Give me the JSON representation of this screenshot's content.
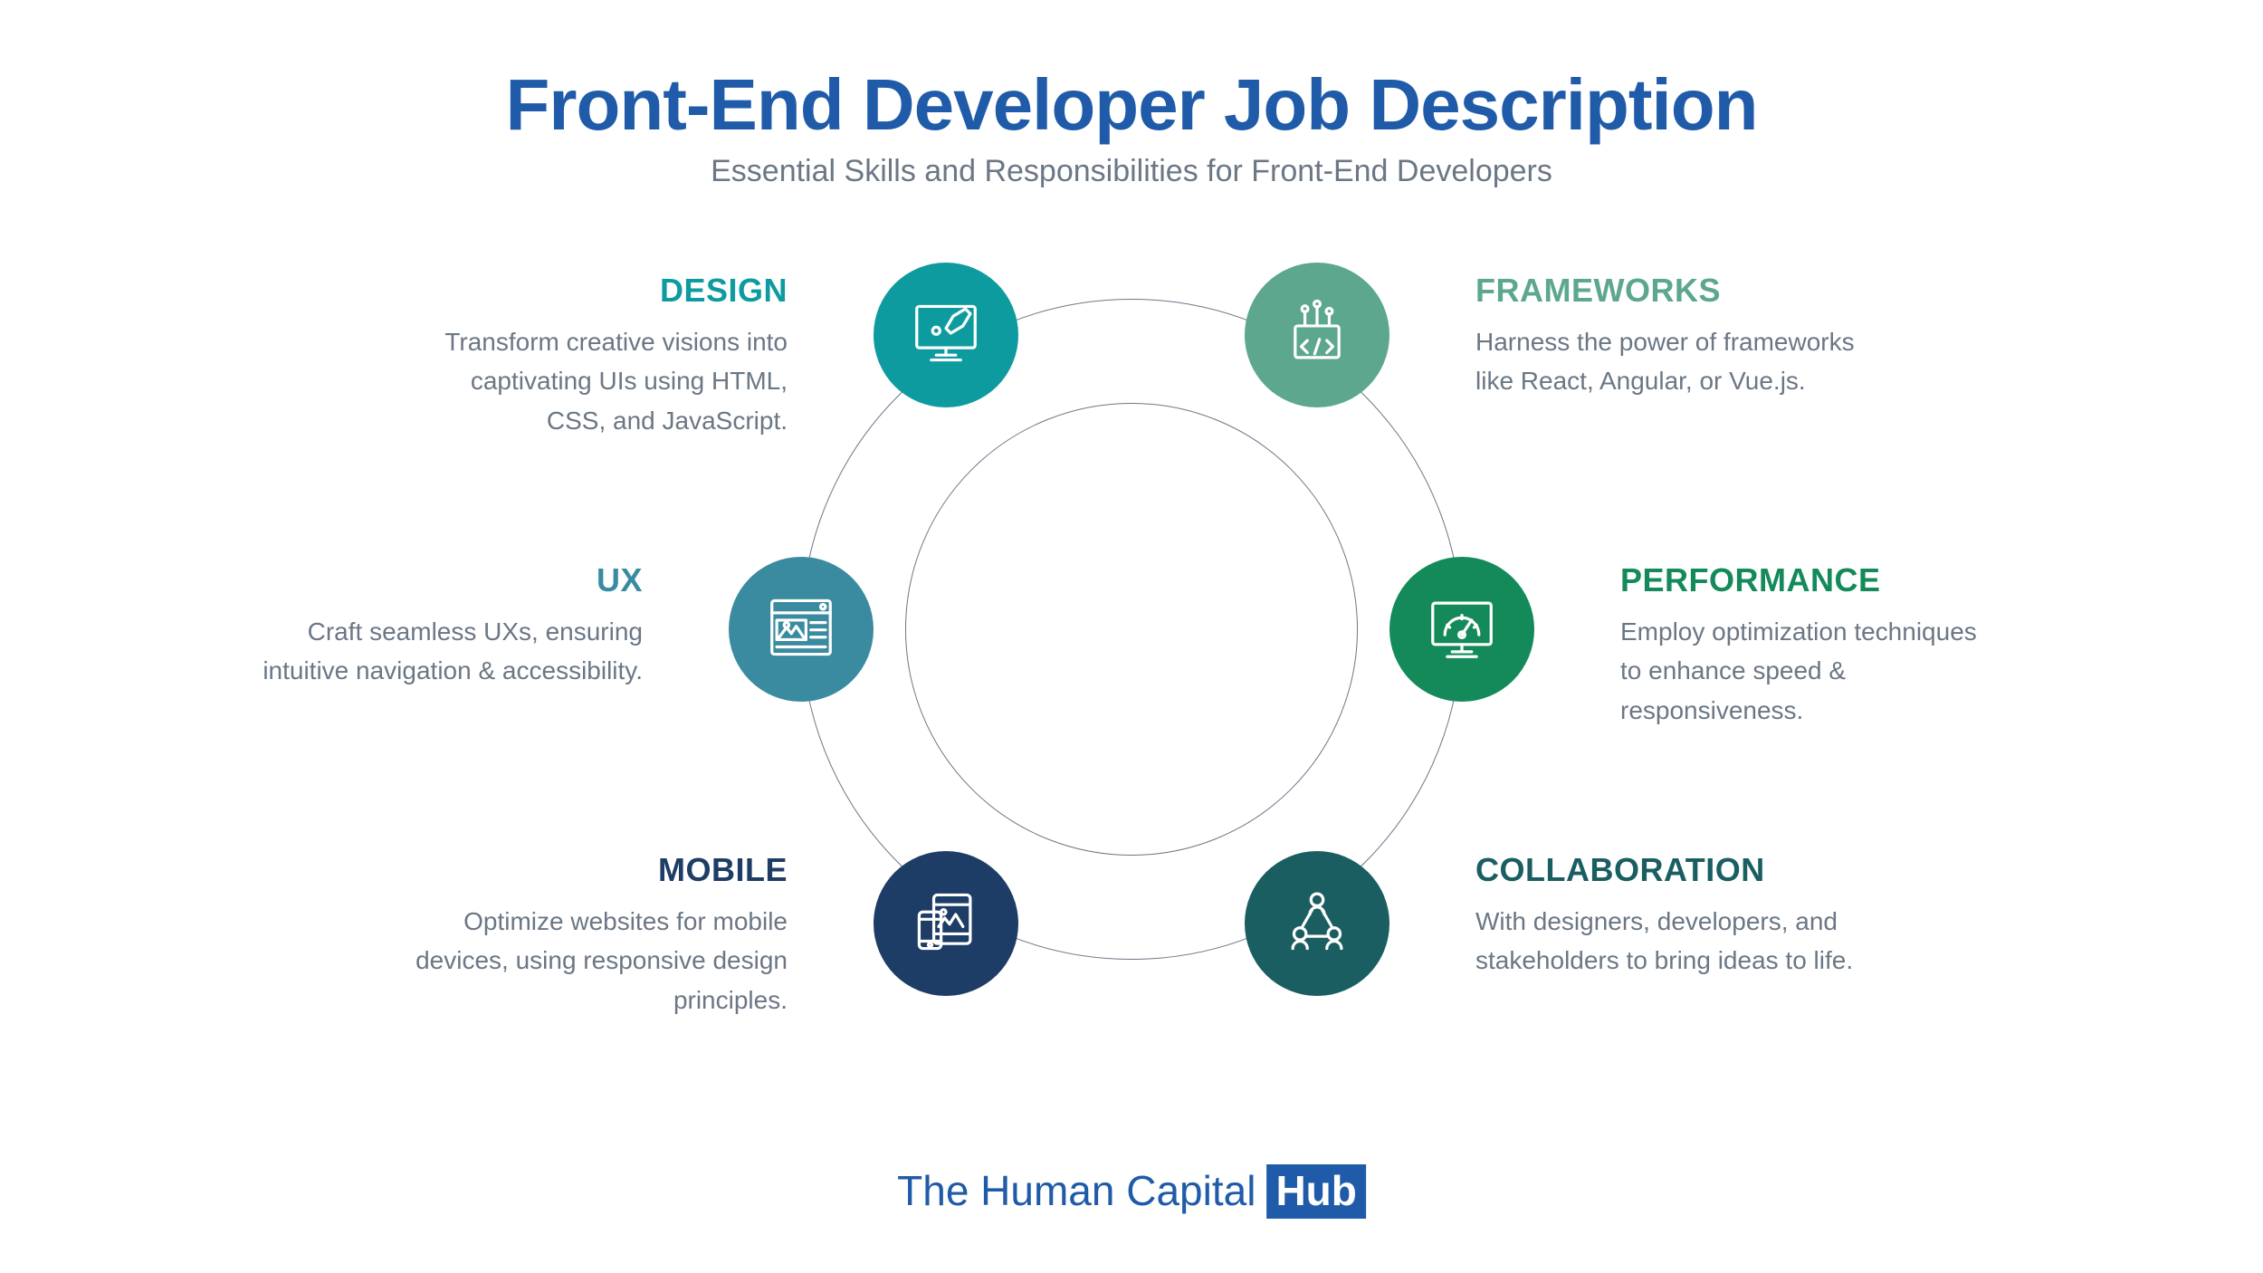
{
  "header": {
    "title": "Front-End Developer Job Description",
    "subtitle": "Essential Skills and Responsibilities for Front-End Developers"
  },
  "items": [
    {
      "label": "DESIGN",
      "desc": "Transform creative visions into captivating UIs using HTML, CSS, and JavaScript.",
      "color": "#0e9ba0",
      "label_color": "#0e9ba0",
      "icon": "design-monitor-brush-icon"
    },
    {
      "label": "FRAMEWORKS",
      "desc": "Harness the power of frameworks like React, Angular, or Vue.js.",
      "color": "#5ca78d",
      "label_color": "#5ca78d",
      "icon": "frameworks-toolbox-icon"
    },
    {
      "label": "UX",
      "desc": "Craft seamless UXs, ensuring intuitive navigation & accessibility.",
      "color": "#3a8ba0",
      "label_color": "#3a8ba0",
      "icon": "ux-wireframe-icon"
    },
    {
      "label": "PERFORMANCE",
      "desc": "Employ optimization techniques to enhance speed & responsiveness.",
      "color": "#148a5a",
      "label_color": "#148a5a",
      "icon": "performance-gauge-icon"
    },
    {
      "label": "MOBILE",
      "desc": "Optimize websites for mobile devices, using responsive design principles.",
      "color": "#1e3d66",
      "label_color": "#1e3d66",
      "icon": "mobile-devices-icon"
    },
    {
      "label": "COLLABORATION",
      "desc": "With designers, developers, and stakeholders to bring ideas to life.",
      "color": "#1b5e62",
      "label_color": "#1b5e62",
      "icon": "collaboration-people-icon"
    }
  ],
  "footer": {
    "brand_pre": "The Human Capital",
    "brand_box": "Hub"
  }
}
